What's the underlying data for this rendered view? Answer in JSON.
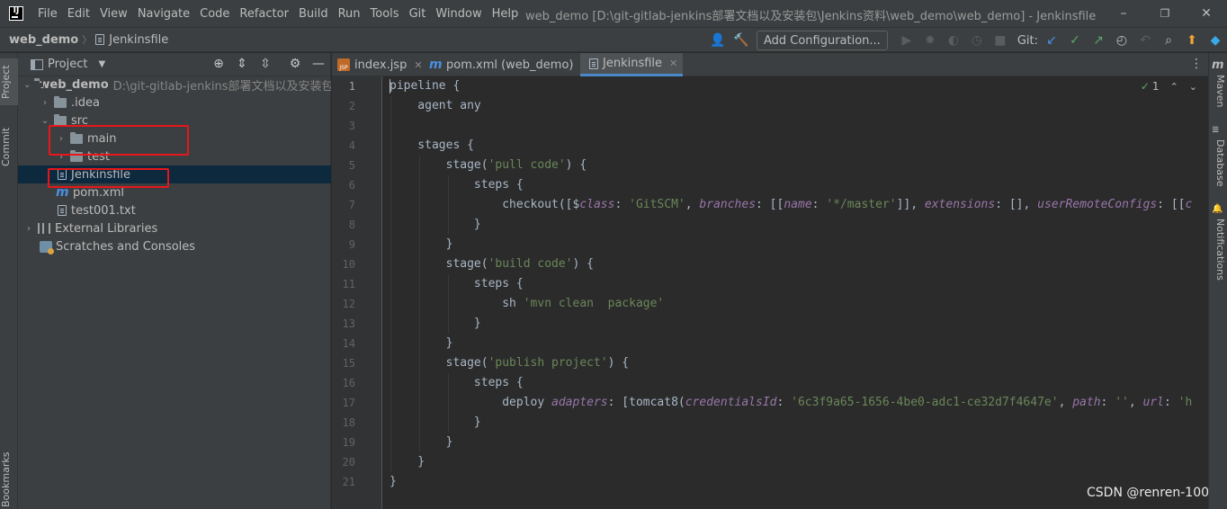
{
  "menubar": {
    "logo_text": "IJ",
    "items": [
      "File",
      "Edit",
      "View",
      "Navigate",
      "Code",
      "Refactor",
      "Build",
      "Run",
      "Tools",
      "Git",
      "Window",
      "Help"
    ],
    "window_title": "web_demo [D:\\git-gitlab-jenkins部署文档以及安装包\\Jenkins资料\\web_demo\\web_demo] - Jenkinsfile",
    "minimize": "–",
    "maximize": "❐",
    "close": "✕"
  },
  "navbar": {
    "project": "web_demo",
    "separator": "〉",
    "file": "Jenkinsfile",
    "add_configuration": "Add Configuration...",
    "git_label": "Git:"
  },
  "left_strip": {
    "project_tab": "Project",
    "commit_tab": "Commit",
    "bookmarks_tab": "Bookmarks"
  },
  "project_panel": {
    "title": "Project",
    "dropdown": "▼",
    "tree": {
      "root_name": "web_demo",
      "root_path": "D:\\git-gitlab-jenkins部署文档以及安装包\\Jenkins资料\\web_demo\\web_demo",
      "idea": ".idea",
      "src": "src",
      "main": "main",
      "test": "test",
      "jenkinsfile": "Jenkinsfile",
      "pom": "pom.xml",
      "test001": "test001.txt",
      "external_libraries": "External Libraries",
      "scratches": "Scratches and Consoles"
    }
  },
  "editor_tabs": [
    {
      "label": "index.jsp",
      "icon": "jsp-file-icon"
    },
    {
      "label": "pom.xml (web_demo)",
      "icon": "maven-icon"
    },
    {
      "label": "Jenkinsfile",
      "icon": "file-icon",
      "active": true
    }
  ],
  "editor": {
    "inspection_count": "1",
    "line_numbers": [
      "1",
      "2",
      "3",
      "4",
      "5",
      "6",
      "7",
      "8",
      "9",
      "10",
      "11",
      "12",
      "13",
      "14",
      "15",
      "16",
      "17",
      "18",
      "19",
      "20",
      "21"
    ]
  },
  "right_strip": {
    "maven_tab": "Maven",
    "database_tab": "Database",
    "notifications_tab": "Notifications"
  },
  "watermark": "CSDN @renren-100",
  "colors": {
    "background": "#2b2b2b",
    "panel": "#3c3f41",
    "string": "#6a8759",
    "parameter": "#9876aa",
    "selection": "#0d293e",
    "highlight_box": "#e8161a",
    "active_tab_underline": "#4a88c7"
  }
}
